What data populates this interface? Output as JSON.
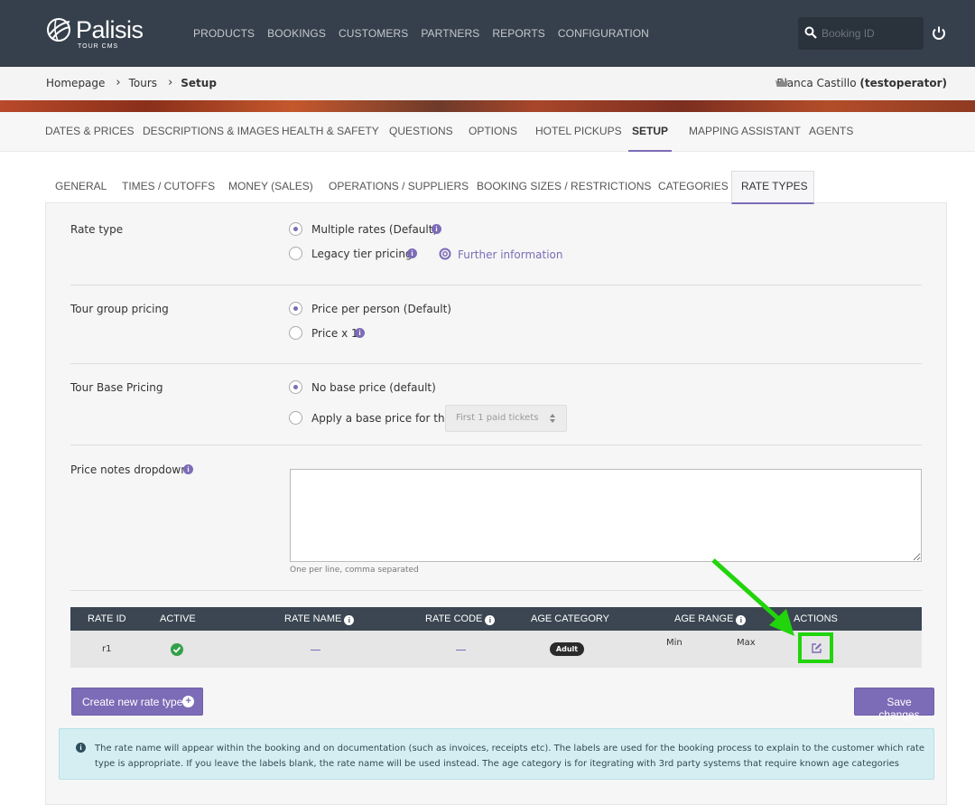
{
  "app": {
    "logo_name": "Palisis",
    "logo_sub": "TOUR CMS"
  },
  "nav": {
    "items": [
      "PRODUCTS",
      "BOOKINGS",
      "CUSTOMERS",
      "PARTNERS",
      "REPORTS",
      "CONFIGURATION"
    ],
    "search_placeholder": "Booking ID"
  },
  "breadcrumb": {
    "items": [
      "Homepage",
      "Tours",
      "Setup"
    ]
  },
  "user": {
    "name": "Blanca Castillo",
    "account": "(testoperator)"
  },
  "tabs": {
    "items": [
      "DATES & PRICES",
      "DESCRIPTIONS & IMAGES",
      "HEALTH & SAFETY",
      "QUESTIONS",
      "OPTIONS",
      "HOTEL PICKUPS",
      "SETUP",
      "MAPPING ASSISTANT",
      "AGENTS"
    ],
    "active": "SETUP"
  },
  "subtabs": {
    "items": [
      "GENERAL",
      "TIMES / CUTOFFS",
      "MONEY (SALES)",
      "OPERATIONS / SUPPLIERS",
      "BOOKING SIZES / RESTRICTIONS",
      "CATEGORIES",
      "RATE TYPES"
    ],
    "active": "RATE TYPES"
  },
  "rate_type": {
    "label": "Rate type",
    "opt1": "Multiple rates (Default)",
    "opt2": "Legacy tier pricing",
    "further": "Further information",
    "selected": "Multiple rates (Default)"
  },
  "group_pricing": {
    "label": "Tour group pricing",
    "opt1": "Price per person (Default)",
    "opt2": "Price x 1",
    "selected": "Price per person (Default)"
  },
  "base_pricing": {
    "label": "Tour Base Pricing",
    "opt1": "No base price (default)",
    "opt2": "Apply a base price for the",
    "select_value": "First 1 paid tickets",
    "selected": "No base price (default)"
  },
  "price_notes": {
    "label": "Price notes dropdown",
    "value": "",
    "hint": "One per line, comma separated"
  },
  "table": {
    "headers": [
      "RATE ID",
      "ACTIVE",
      "RATE NAME",
      "RATE CODE",
      "AGE CATEGORY",
      "AGE RANGE",
      "ACTIONS"
    ],
    "rows": [
      {
        "rate_id": "r1",
        "active": true,
        "rate_name": "",
        "rate_code": "",
        "age_category": "Adult",
        "age_min": "Min",
        "age_max": "Max"
      }
    ]
  },
  "buttons": {
    "create": "Create new rate type",
    "save": "Save changes"
  },
  "notice": {
    "text": "The rate name will appear within the booking and on documentation (such as invoices, receipts etc). The labels are used for the booking process to explain to the customer which rate type is appropriate. If you leave the labels blank, the rate name will be used instead. The age category is for itegrating with 3rd party systems that require known age categories"
  },
  "colors": {
    "topbar": "#36404c",
    "accent": "#7c6cb7",
    "table_header": "#3b4652",
    "highlight": "#21d40b",
    "active_green": "#33a04b",
    "notice_bg": "#d5eef2"
  }
}
